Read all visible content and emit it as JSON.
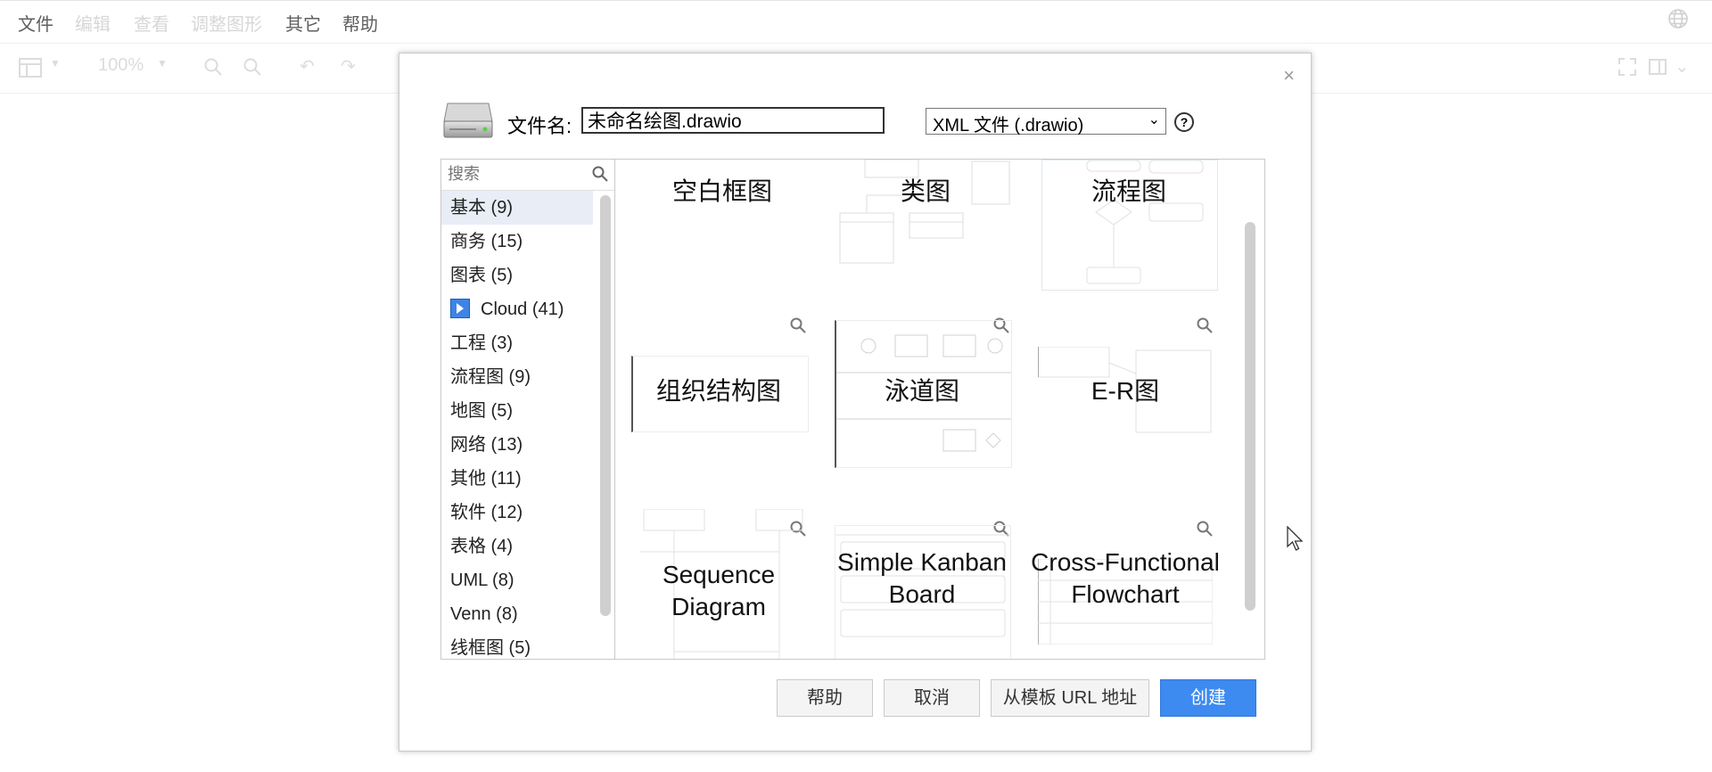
{
  "menubar": {
    "items": [
      "文件",
      "编辑",
      "查看",
      "调整图形",
      "其它",
      "帮助"
    ]
  },
  "toolbar": {
    "zoom": "100%"
  },
  "dialog": {
    "filename_label": "文件名:",
    "filename_value": "未命名绘图.drawio",
    "file_type": "XML 文件 (.drawio)",
    "help_symbol": "?",
    "close_symbol": "×",
    "search_placeholder": "搜索",
    "categories": [
      "基本 (9)",
      "商务 (15)",
      "图表 (5)",
      "Cloud (41)",
      "工程 (3)",
      "流程图 (9)",
      "地图 (5)",
      "网络 (13)",
      "其他 (11)",
      "软件 (12)",
      "表格 (4)",
      "UML (8)",
      "Venn (8)",
      "线框图 (5)"
    ],
    "selected_category": "基本 (9)",
    "templates": {
      "t1": "空白框图",
      "t2": "类图",
      "t3": "流程图",
      "t4": "组织结构图",
      "t5": "泳道图",
      "t6": "E-R图",
      "t7": "Sequence Diagram",
      "t8": "Simple Kanban Board",
      "t9": "Cross-Functional Flowchart"
    },
    "buttons": {
      "help": "帮助",
      "cancel": "取消",
      "from_url": "从模板 URL 地址",
      "create": "创建"
    }
  },
  "colors": {
    "primary": "#3d8af0",
    "selected_row": "#e8edf6"
  }
}
